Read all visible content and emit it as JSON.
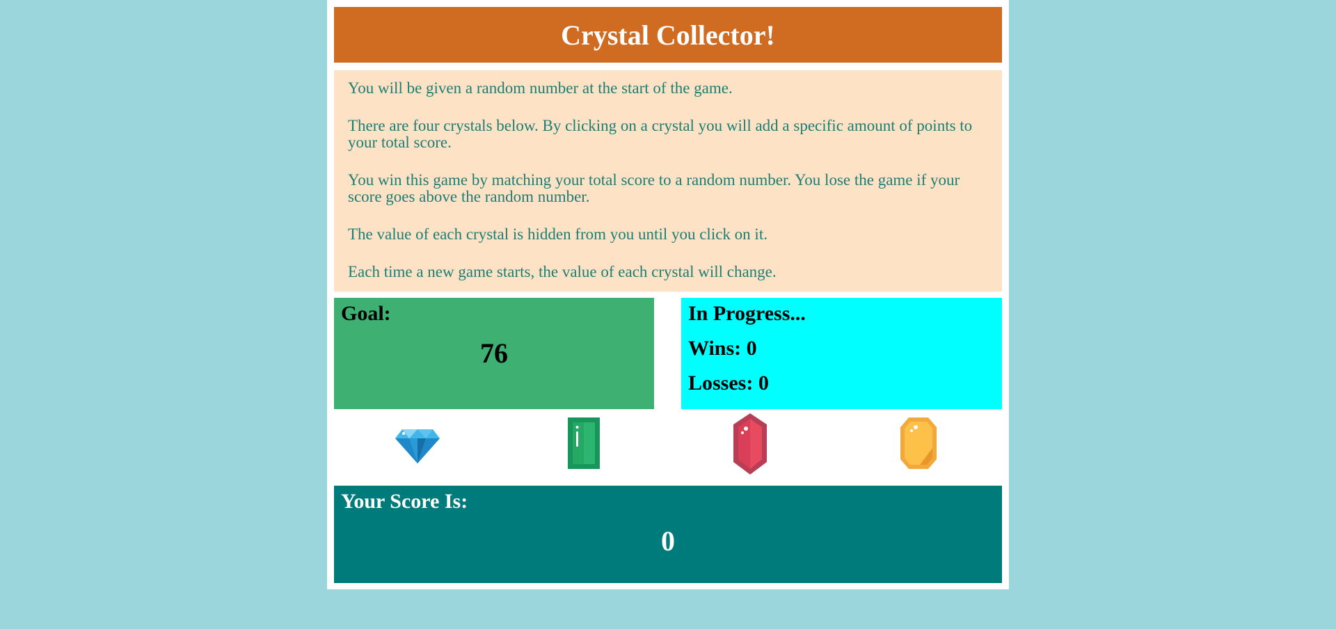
{
  "header": {
    "title": "Crystal Collector!"
  },
  "instructions": [
    "You will be given a random number at the start of the game.",
    "There are four crystals below. By clicking on a crystal you will add a specific amount of points to your total score.",
    "You win this game by matching your total score to a random number. You lose the game if your score goes above the random number.",
    "The value of each crystal is hidden from you until you click on it.",
    "Each time a new game starts, the value of each crystal will change."
  ],
  "goal": {
    "label": "Goal:",
    "value": "76"
  },
  "status": {
    "state": "In Progress...",
    "wins": "Wins: 0",
    "losses": "Losses: 0"
  },
  "crystals": [
    {
      "icon": "blue-diamond-icon",
      "color": "#29a9e1"
    },
    {
      "icon": "green-emerald-icon",
      "color": "#1ea25a"
    },
    {
      "icon": "red-ruby-icon",
      "color": "#e0475d"
    },
    {
      "icon": "yellow-topaz-icon",
      "color": "#fbbd3a"
    }
  ],
  "score": {
    "label": "Your Score Is:",
    "value": "0"
  },
  "colors": {
    "background": "#9ad6dc",
    "header": "#d06b22",
    "instructions_bg": "#fde2c6",
    "instructions_text": "#1e7d73",
    "goal_bg": "#3db072",
    "status_bg": "#00ffff",
    "score_bg": "#007b7b"
  }
}
